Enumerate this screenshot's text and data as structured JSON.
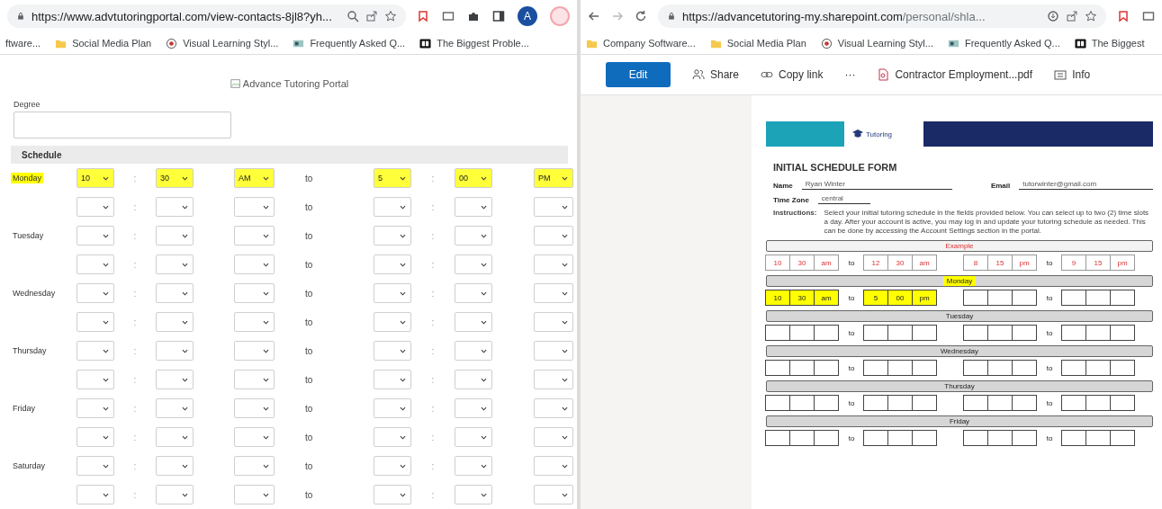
{
  "left_window": {
    "url": "https://www.advtutoringportal.com/view-contacts-8jl8?yh...",
    "profile_initial": "A",
    "bookmarks": [
      {
        "label": "ftware...",
        "kind": "none"
      },
      {
        "label": "Social Media Plan",
        "kind": "folder"
      },
      {
        "label": "Visual Learning Styl...",
        "kind": "target"
      },
      {
        "label": "Frequently Asked Q...",
        "kind": "doc"
      },
      {
        "label": "The Biggest Proble...",
        "kind": "film"
      }
    ],
    "portal": {
      "logo_alt": "Advance Tutoring Portal",
      "degree_label": "Degree",
      "schedule_heading": "Schedule",
      "days": [
        {
          "label": "Monday",
          "highlighted": true,
          "rows": [
            {
              "values": [
                "10",
                "30",
                "AM",
                "5",
                "00",
                "PM"
              ],
              "highlighted": true,
              "sep": [
                ":",
                ":"
              ],
              "to": "to"
            },
            {
              "highlighted": false,
              "sep": [
                ":",
                ":"
              ],
              "to": "to"
            }
          ]
        },
        {
          "label": "Tuesday",
          "highlighted": false,
          "rows": [
            {
              "highlighted": false,
              "sep": [
                ":",
                ":"
              ],
              "to": "to"
            },
            {
              "highlighted": false,
              "sep": [
                ":",
                ":"
              ],
              "to": "to"
            }
          ]
        },
        {
          "label": "Wednesday",
          "highlighted": false,
          "rows": [
            {
              "highlighted": false,
              "sep": [
                ":",
                ":"
              ],
              "to": "to"
            },
            {
              "highlighted": false,
              "sep": [
                ":",
                ":"
              ],
              "to": "to"
            }
          ]
        },
        {
          "label": "Thursday",
          "highlighted": false,
          "rows": [
            {
              "highlighted": false,
              "sep": [
                ":",
                ":"
              ],
              "to": "to"
            },
            {
              "highlighted": false,
              "sep": [
                ":",
                ":"
              ],
              "to": "to"
            }
          ]
        },
        {
          "label": "Friday",
          "highlighted": false,
          "rows": [
            {
              "highlighted": false,
              "sep": [
                ":",
                ":"
              ],
              "to": "to"
            },
            {
              "highlighted": false,
              "sep": [
                ":",
                ":"
              ],
              "to": "to"
            }
          ]
        },
        {
          "label": "Saturday",
          "highlighted": false,
          "rows": [
            {
              "highlighted": false,
              "sep": [
                ":",
                ":"
              ],
              "to": "to"
            },
            {
              "highlighted": false,
              "sep": [
                ":",
                ":"
              ],
              "to": "to"
            }
          ]
        }
      ]
    }
  },
  "right_window": {
    "url_host": "https://advancetutoring-my.sharepoint.com",
    "url_path": "/personal/shla...",
    "bookmarks": [
      {
        "label": "Company Software...",
        "kind": "folder"
      },
      {
        "label": "Social Media Plan",
        "kind": "folder"
      },
      {
        "label": "Visual Learning Styl...",
        "kind": "target"
      },
      {
        "label": "Frequently Asked Q...",
        "kind": "doc"
      },
      {
        "label": "The Biggest",
        "kind": "film"
      }
    ],
    "toolbar": {
      "edit": "Edit",
      "share": "Share",
      "copy_link": "Copy link",
      "more": "···",
      "file_name": "Contractor Employment...pdf",
      "info": "Info"
    },
    "document": {
      "logo_text": "Tutoring",
      "title": "INITIAL SCHEDULE FORM",
      "name_label": "Name",
      "name_value": "Ryan Winter",
      "email_label": "Email",
      "email_value": "tutorwinter@gmail.com",
      "timezone_label": "Time Zone",
      "timezone_value": "central",
      "instructions_label": "Instructions:",
      "instructions": "Select your initial tutoring schedule in the fields provided below. You can select up to two (2) time slots a day. After your account is active, you may log in and update your tutoring schedule as needed. This can be done by accessing the Account Settings section in the portal.",
      "days": [
        {
          "label": "Example",
          "kind": "example",
          "highlighted": false,
          "slots": [
            {
              "start": [
                "10",
                "30",
                "am"
              ],
              "to": "to",
              "end": [
                "12",
                "30",
                "am"
              ],
              "highlighted": false
            },
            {
              "start": [
                "8",
                "15",
                "pm"
              ],
              "to": "to",
              "end": [
                "9",
                "15",
                "pm"
              ],
              "highlighted": false
            }
          ]
        },
        {
          "label": "Monday",
          "kind": "day",
          "highlighted": true,
          "slots": [
            {
              "start": [
                "10",
                "30",
                "am"
              ],
              "to": "to",
              "end": [
                "5",
                "00",
                "pm"
              ],
              "highlighted": true
            },
            {
              "to": "to",
              "highlighted": false
            }
          ]
        },
        {
          "label": "Tuesday",
          "kind": "day",
          "highlighted": false,
          "slots": [
            {
              "to": "to",
              "highlighted": false
            },
            {
              "to": "to",
              "highlighted": false
            }
          ]
        },
        {
          "label": "Wednesday",
          "kind": "day",
          "highlighted": false,
          "slots": [
            {
              "to": "to",
              "highlighted": false
            },
            {
              "to": "to",
              "highlighted": false
            }
          ]
        },
        {
          "label": "Thursday",
          "kind": "day",
          "highlighted": false,
          "slots": [
            {
              "to": "to",
              "highlighted": false
            },
            {
              "to": "to",
              "highlighted": false
            }
          ]
        },
        {
          "label": "Friday",
          "kind": "day",
          "highlighted": false,
          "slots": [
            {
              "to": "to",
              "highlighted": false
            },
            {
              "to": "to",
              "highlighted": false
            }
          ]
        }
      ]
    }
  }
}
